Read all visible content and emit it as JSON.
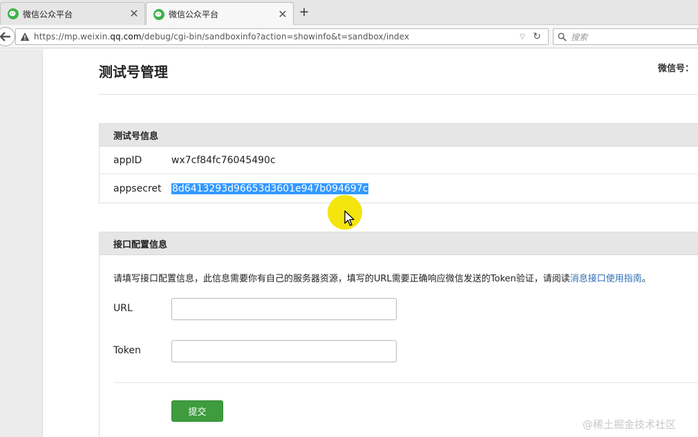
{
  "browser": {
    "tabs": [
      {
        "title": "微信公众平台",
        "active": false
      },
      {
        "title": "微信公众平台",
        "active": true
      }
    ],
    "new_tab_label": "+",
    "close_label": "✕",
    "url": {
      "prefix": "https://mp.weixin.",
      "domain": "qq.com",
      "path": "/debug/cgi-bin/sandboxinfo?action=showinfo&t=sandbox/index"
    },
    "search_placeholder": "搜索"
  },
  "page": {
    "title": "测试号管理",
    "wechat_id_label": "微信号："
  },
  "test_account_panel": {
    "heading": "测试号信息",
    "rows": [
      {
        "label": "appID",
        "value": "wx7cf84fc76045490c"
      },
      {
        "label": "appsecret",
        "value": "8d6413293d96653d3601e947b094697c"
      }
    ]
  },
  "interface_panel": {
    "heading": "接口配置信息",
    "description": "请填写接口配置信息，此信息需要你有自己的服务器资源，填写的URL需要正确响应微信发送的Token验证，请阅读",
    "link_text": "消息接口使用指南",
    "description_end": "。",
    "fields": [
      {
        "label": "URL",
        "value": ""
      },
      {
        "label": "Token",
        "value": ""
      }
    ],
    "submit_label": "提交"
  },
  "watermark": "@稀土掘金技术社区",
  "colors": {
    "accent_green": "#3e9c3e",
    "link_blue": "#2f6fb8",
    "selection_blue": "#3399ff",
    "cursor_highlight": "#f2e400"
  },
  "icons": [
    "wechat-icon",
    "close-icon",
    "plus-icon",
    "back-arrow-icon",
    "warning-icon",
    "dropdown-icon",
    "reload-icon",
    "search-icon",
    "mouse-pointer-icon"
  ]
}
